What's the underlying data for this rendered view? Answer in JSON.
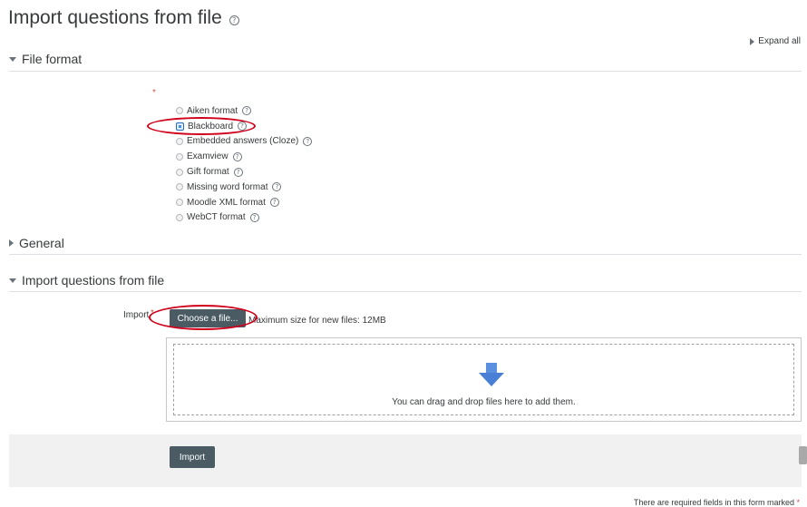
{
  "page": {
    "title": "Import questions from file",
    "expand_all": "Expand all"
  },
  "sections": {
    "file_format": "File format",
    "general": "General",
    "import_from_file": "Import questions from file"
  },
  "required_marker": "*",
  "formats": [
    {
      "label": "Aiken format",
      "selected": false
    },
    {
      "label": "Blackboard",
      "selected": true
    },
    {
      "label": "Embedded answers (Cloze)",
      "selected": false
    },
    {
      "label": "Examview",
      "selected": false
    },
    {
      "label": "Gift format",
      "selected": false
    },
    {
      "label": "Missing word format",
      "selected": false
    },
    {
      "label": "Moodle XML format",
      "selected": false
    },
    {
      "label": "WebCT format",
      "selected": false
    }
  ],
  "import_field": {
    "label": "Import",
    "choose_button": "Choose a file...",
    "max_size": "Maximum size for new files: 12MB",
    "drop_text": "You can drag and drop files here to add them."
  },
  "footer": {
    "import_button": "Import",
    "required_note": "There are required fields in this form marked"
  },
  "colors": {
    "button_bg": "#4a5b64",
    "required_red": "#d9534f",
    "annotation_red": "#d0021b",
    "drop_arrow": "#5b8fe0"
  }
}
